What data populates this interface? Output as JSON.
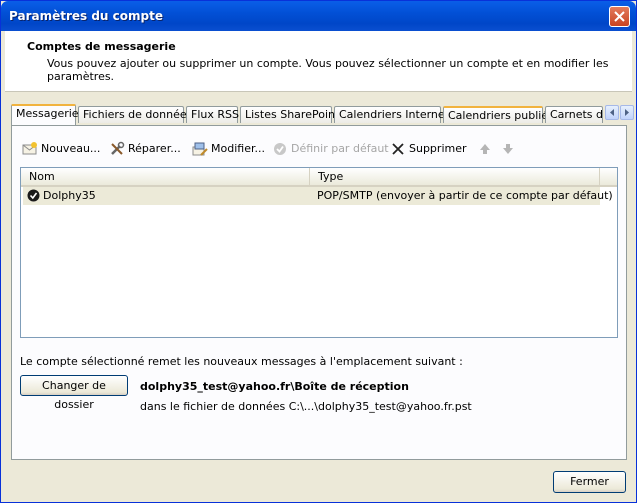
{
  "window": {
    "title": "Paramètres du compte"
  },
  "header": {
    "title": "Comptes de messagerie",
    "description": "Vous pouvez ajouter ou supprimer un compte. Vous pouvez sélectionner un compte et en modifier les paramètres."
  },
  "tabs": [
    {
      "label": "Messagerie",
      "active": true
    },
    {
      "label": "Fichiers de données"
    },
    {
      "label": "Flux RSS"
    },
    {
      "label": "Listes SharePoint"
    },
    {
      "label": "Calendriers Internet"
    },
    {
      "label": "Calendriers publiés"
    },
    {
      "label": "Carnets d"
    }
  ],
  "toolbar": {
    "new": "Nouveau...",
    "repair": "Réparer...",
    "modify": "Modifier...",
    "set_default": "Définir par défaut",
    "delete": "Supprimer"
  },
  "list": {
    "headers": {
      "name": "Nom",
      "type": "Type"
    },
    "rows": [
      {
        "name": "Dolphy35",
        "type": "POP/SMTP (envoyer à partir de ce compte par défaut)"
      }
    ]
  },
  "delivery": {
    "label": "Le compte sélectionné remet les nouveaux messages à l'emplacement suivant :",
    "change_folder_button": "Changer de dossier",
    "address": "dolphy35_test@yahoo.fr\\Boîte de réception",
    "data_file": "dans le fichier de données C:\\...\\dolphy35_test@yahoo.fr.pst"
  },
  "footer": {
    "close_button": "Fermer"
  },
  "colors": {
    "titlebar": "#0054e3",
    "tab_highlight": "#f1b33e",
    "selected_row": "#ecead8"
  }
}
